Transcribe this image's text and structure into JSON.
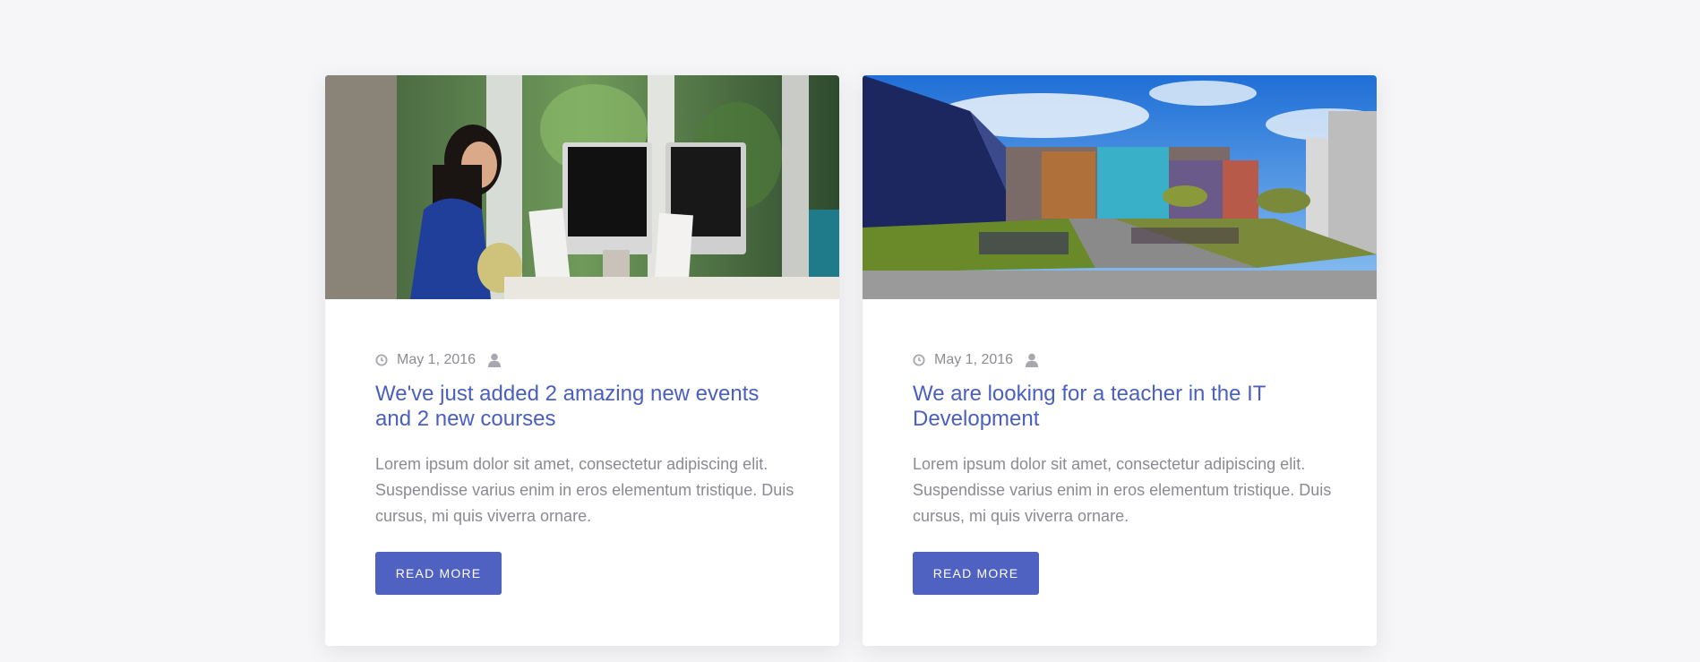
{
  "posts": [
    {
      "date": "May 1, 2016",
      "title": "We've just added 2 amazing new events and 2 new courses",
      "excerpt": "Lorem ipsum dolor sit amet, consectetur adipiscing elit. Suspendisse varius enim in eros elementum tristique. Duis cursus, mi quis viverra ornare.",
      "button_label": "READ MORE",
      "image": "student-at-computer-photo"
    },
    {
      "date": "May 1, 2016",
      "title": "We are looking for a teacher in the IT Development",
      "excerpt": "Lorem ipsum dolor sit amet, consectetur adipiscing elit. Suspendisse varius enim in eros elementum tristique. Duis cursus, mi quis viverra ornare.",
      "button_label": "READ MORE",
      "image": "campus-building-photo"
    }
  ],
  "colors": {
    "accent": "#4f62c2",
    "title": "#4a5fbf",
    "text": "#8a8a92",
    "background": "#f6f6f8"
  }
}
